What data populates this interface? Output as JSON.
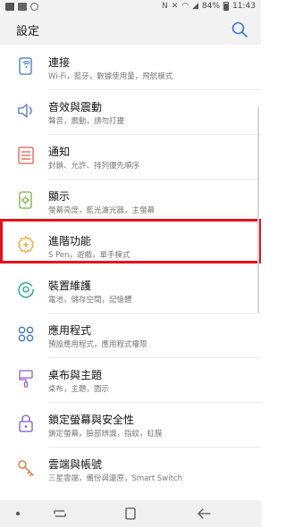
{
  "status_bar": {
    "battery": "84%",
    "time": "11:43"
  },
  "header": {
    "title": "設定"
  },
  "settings": [
    {
      "title": "連接",
      "subtitle": "Wi-Fi，藍牙，數據使用量，飛航模式",
      "icon": "connection-icon",
      "color": "#3b78c9"
    },
    {
      "title": "音效與震動",
      "subtitle": "聲音，震動，請勿打擾",
      "icon": "speaker-icon",
      "color": "#5b6ec9"
    },
    {
      "title": "通知",
      "subtitle": "封鎖、允許、排列優先順序",
      "icon": "notification-icon",
      "color": "#e0604e"
    },
    {
      "title": "顯示",
      "subtitle": "螢幕亮度，藍光濾光器，主螢幕",
      "icon": "display-icon",
      "color": "#7ab03c"
    },
    {
      "title": "進階功能",
      "subtitle": "S Pen，遊戲，單手模式",
      "icon": "gear-plus-icon",
      "color": "#e8a634"
    },
    {
      "title": "裝置維護",
      "subtitle": "電池，儲存空間，記憶體",
      "icon": "device-care-icon",
      "color": "#23a890"
    },
    {
      "title": "應用程式",
      "subtitle": "預設應用程式，應用程式權限",
      "icon": "apps-icon",
      "color": "#3b78c9"
    },
    {
      "title": "桌布與主題",
      "subtitle": "桌布，主題，圖示",
      "icon": "brush-icon",
      "color": "#9b5fc6"
    },
    {
      "title": "鎖定螢幕與安全性",
      "subtitle": "鎖定螢幕，臉部辨識，指紋，虹膜",
      "icon": "lock-icon",
      "color": "#7d57c8"
    },
    {
      "title": "雲端與帳號",
      "subtitle": "三星雲端，備份與還原，Smart Switch",
      "icon": "key-icon",
      "color": "#e07a3a"
    }
  ],
  "colors": {
    "highlight": "#e3121f",
    "search": "#3b78c9"
  }
}
